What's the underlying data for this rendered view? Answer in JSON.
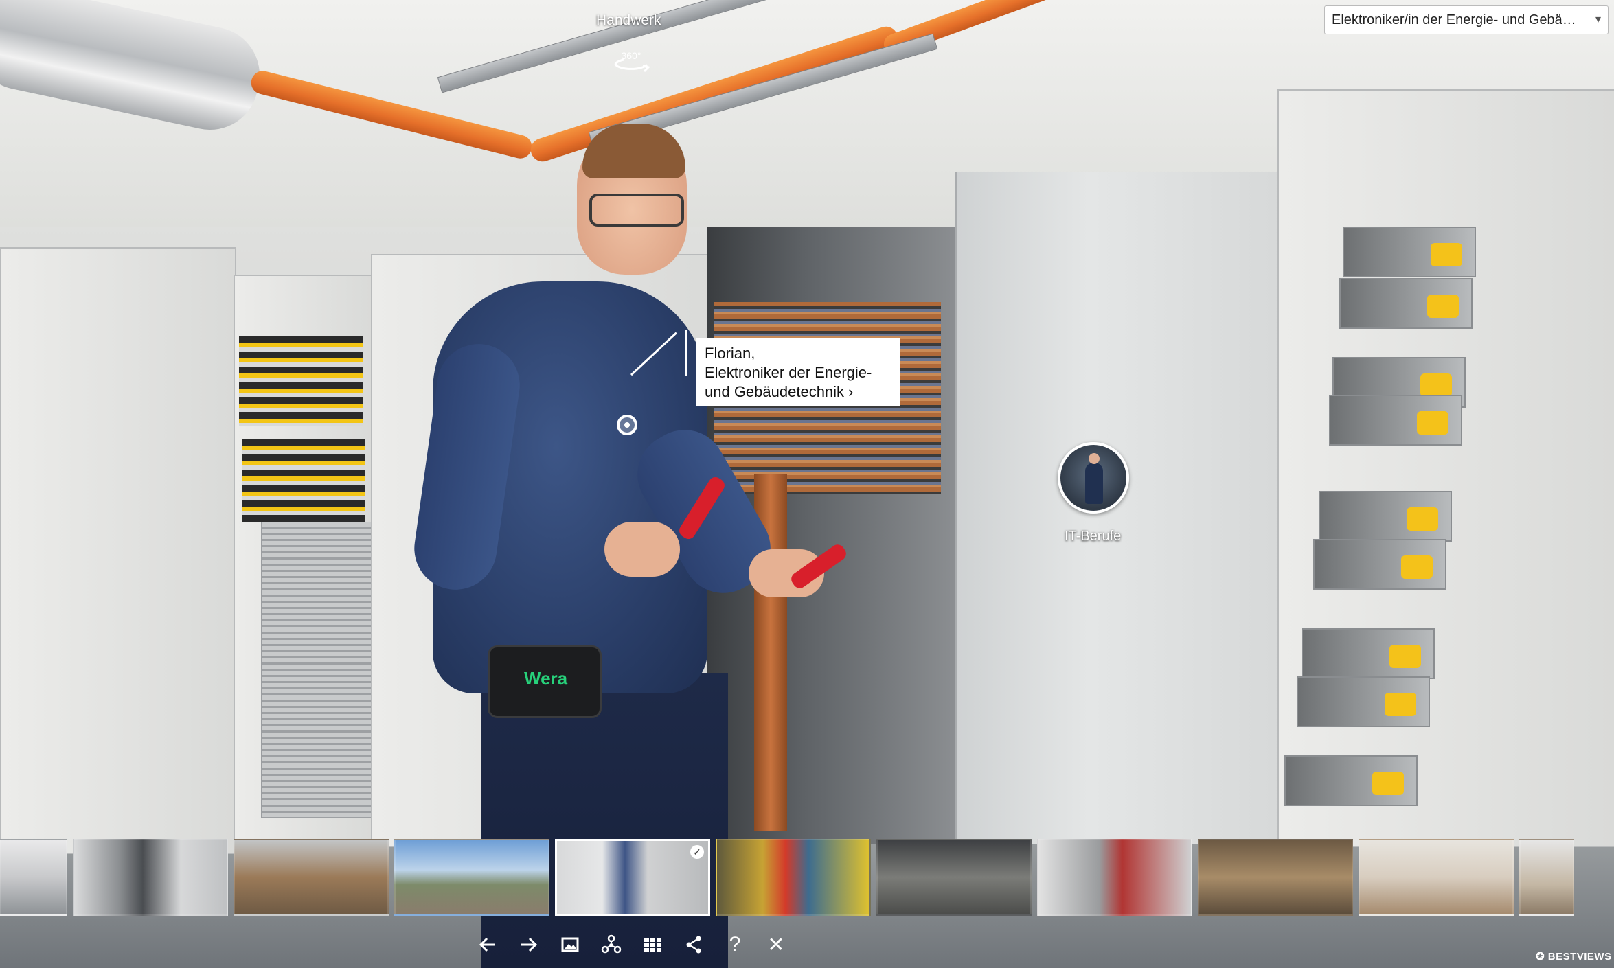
{
  "header": {
    "scene_title": "Handwerk",
    "scene_selector_value": "Elektroniker/in der Energie- und Gebäud..."
  },
  "hotspot": {
    "info_line1": "Florian,",
    "info_line2": "Elektroniker der Energie-",
    "info_line3": "und Gebäudetechnik ›"
  },
  "nav_link": {
    "label": "IT-Berufe"
  },
  "thumbnails": [
    {
      "name": "scene-1"
    },
    {
      "name": "scene-2"
    },
    {
      "name": "scene-3"
    },
    {
      "name": "scene-4"
    },
    {
      "name": "scene-5",
      "active": true
    },
    {
      "name": "scene-6"
    },
    {
      "name": "scene-7"
    },
    {
      "name": "scene-8"
    },
    {
      "name": "scene-9"
    },
    {
      "name": "scene-10"
    },
    {
      "name": "scene-11"
    }
  ],
  "toolbar": {
    "icons": [
      "arrow-left-icon",
      "arrow-right-icon",
      "image-icon",
      "network-icon",
      "grid-icon",
      "share-icon",
      "help-icon",
      "close-icon"
    ],
    "help_glyph": "?",
    "close_glyph": "✕"
  },
  "brand": {
    "text": "BESTVIEWS"
  },
  "colors": {
    "accent_orange": "#e6702a",
    "suit_blue": "#2a3e68",
    "cabinet_grey": "#e4e6e6"
  }
}
